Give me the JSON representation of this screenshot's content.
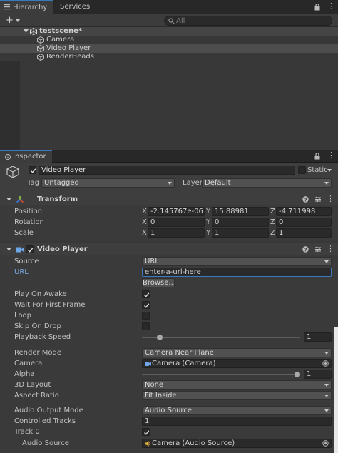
{
  "hierarchy": {
    "tabs": [
      {
        "label": "Hierarchy"
      },
      {
        "label": "Services"
      }
    ],
    "add_label": "+",
    "search_placeholder": "All",
    "scene": "testscene*",
    "items": [
      {
        "label": "Camera"
      },
      {
        "label": "Video Player"
      },
      {
        "label": "RenderHeads"
      }
    ]
  },
  "inspector": {
    "tab_label": "Inspector",
    "object_name": "Video Player",
    "static_label": "Static",
    "tag_label": "Tag",
    "tag_value": "Untagged",
    "layer_label": "Layer",
    "layer_value": "Default"
  },
  "transform": {
    "title": "Transform",
    "rows": [
      {
        "label": "Position",
        "x": "-2.145767e-06",
        "y": "15.88981",
        "z": "-4.711998"
      },
      {
        "label": "Rotation",
        "x": "0",
        "y": "0",
        "z": "0"
      },
      {
        "label": "Scale",
        "x": "1",
        "y": "1",
        "z": "1"
      }
    ],
    "axes": [
      "X",
      "Y",
      "Z"
    ]
  },
  "video_player": {
    "title": "Video Player",
    "source_label": "Source",
    "source_value": "URL",
    "url_label": "URL",
    "url_value": "enter-a-url-here",
    "browse_label": "Browse...",
    "play_on_awake_label": "Play On Awake",
    "play_on_awake": true,
    "wait_first_frame_label": "Wait For First Frame",
    "wait_first_frame": true,
    "loop_label": "Loop",
    "loop": false,
    "skip_on_drop_label": "Skip On Drop",
    "skip_on_drop": false,
    "playback_speed_label": "Playback Speed",
    "playback_speed": "1",
    "playback_speed_fraction": 0.1,
    "render_mode_label": "Render Mode",
    "render_mode_value": "Camera Near Plane",
    "camera_label": "Camera",
    "camera_value": "Camera (Camera)",
    "alpha_label": "Alpha",
    "alpha_value": "1",
    "alpha_fraction": 1.0,
    "layout_label": "3D Layout",
    "layout_value": "None",
    "aspect_label": "Aspect Ratio",
    "aspect_value": "Fit Inside",
    "audio_output_label": "Audio Output Mode",
    "audio_output_value": "Audio Source",
    "controlled_tracks_label": "Controlled Tracks",
    "controlled_tracks_value": "1",
    "track0_label": "Track 0",
    "track0": true,
    "audio_source_label": "Audio Source",
    "audio_source_value": "Camera (Audio Source)"
  },
  "colors": {
    "accent": "#3a79bb",
    "url_label": "#7aa6e0",
    "selection": "#4d4d4d"
  }
}
